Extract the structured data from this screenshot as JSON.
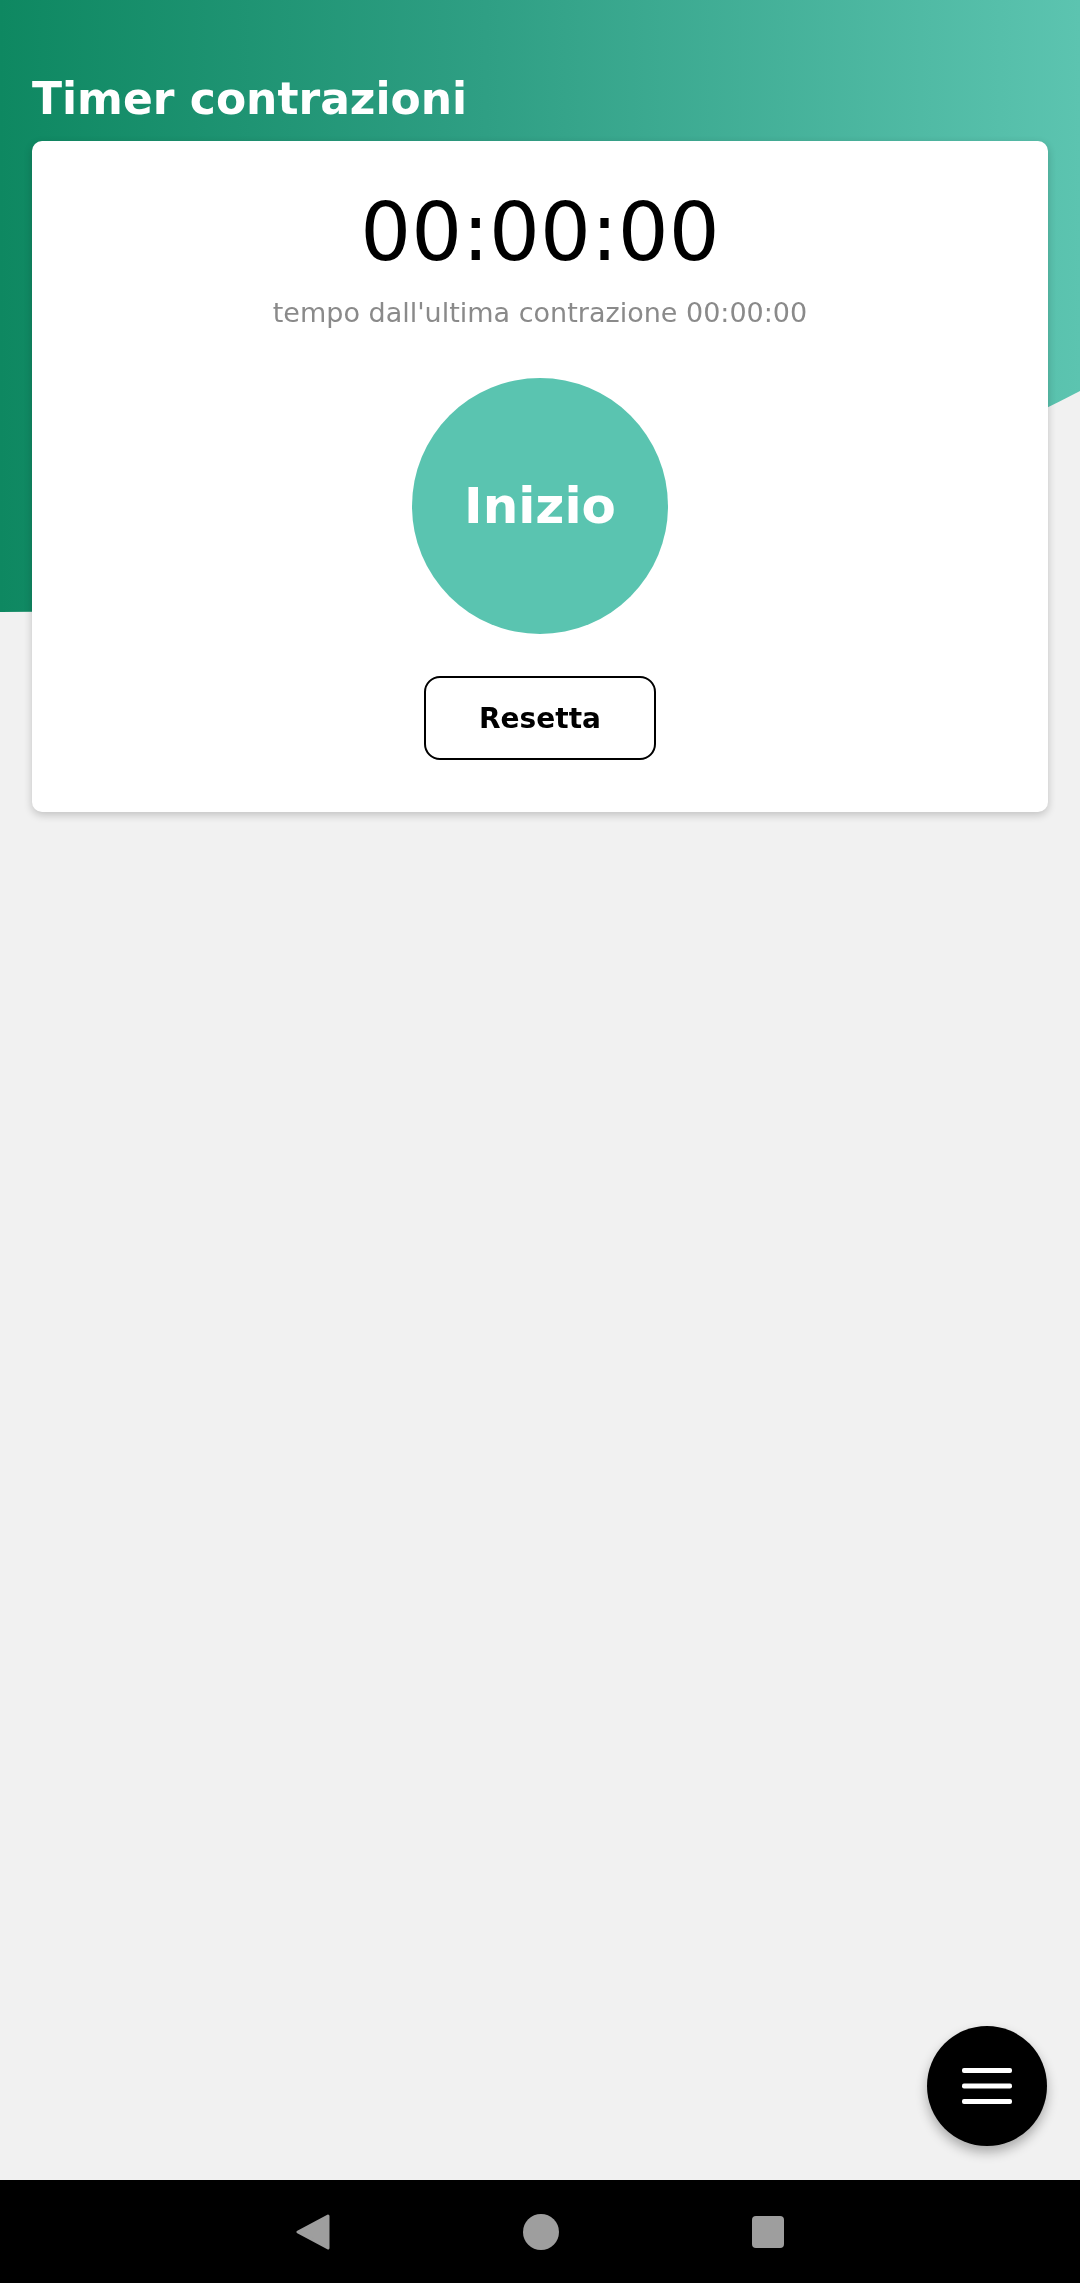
{
  "header": {
    "title": "Timer contrazioni"
  },
  "timer": {
    "elapsed": "00:00:00",
    "since_last": "tempo dall'ultima contrazione 00:00:00"
  },
  "buttons": {
    "start": "Inizio",
    "reset": "Resetta"
  }
}
